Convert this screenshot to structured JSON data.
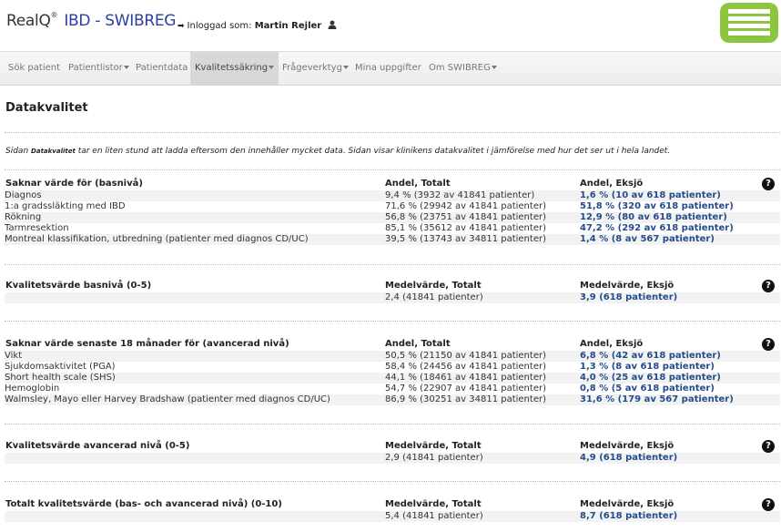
{
  "header": {
    "brand_main": "RealQ",
    "brand_reg": "®",
    "brand_sub": "IBD - SWIBREG",
    "login_prefix": "Inloggad som:",
    "user_name": "Martin Rejler",
    "colors": {
      "brand_blue": "#2a3f9e",
      "logo_green": "#8cc63f",
      "value_blue": "#244c8a"
    }
  },
  "nav": {
    "items": [
      {
        "label": "Sök patient"
      },
      {
        "label": "Patientlistor"
      },
      {
        "label": "Patientdata"
      },
      {
        "label": "Kvalitetssäkring"
      },
      {
        "label": "Frågeverktyg"
      },
      {
        "label": "Mina uppgifter"
      },
      {
        "label": "Om SWIBREG"
      }
    ]
  },
  "page": {
    "title": "Datakvalitet",
    "intro_pre": "Sidan",
    "intro_word": "Datakvalitet",
    "intro_post": "tar en liten stund att ladda eftersom den innehåller mycket data. Sidan visar klinikens datakvalitet i jämförelse med hur det ser ut i hela landet."
  },
  "sections": [
    {
      "heading": "Saknar värde för (basnivå)",
      "col2": "Andel, Totalt",
      "col3": "Andel, Eksjö",
      "rows": [
        {
          "label": "Diagnos",
          "total": "9,4 % (3932 av 41841 patienter)",
          "local": "1,6 % (10 av 618 patienter)"
        },
        {
          "label": "1:a gradssläkting med IBD",
          "total": "71,6 % (29942 av 41841 patienter)",
          "local": "51,8 % (320 av 618 patienter)"
        },
        {
          "label": "Rökning",
          "total": "56,8 % (23751 av 41841 patienter)",
          "local": "12,9 % (80 av 618 patienter)"
        },
        {
          "label": "Tarmresektion",
          "total": "85,1 % (35612 av 41841 patienter)",
          "local": "47,2 % (292 av 618 patienter)"
        },
        {
          "label": "Montreal klassifikation, utbredning (patienter med diagnos CD/UC)",
          "total": "39,5 % (13743 av 34811 patienter)",
          "local": "1,4 % (8 av 567 patienter)"
        }
      ]
    },
    {
      "heading": "Kvalitetsvärde basnivå (0-5)",
      "col2": "Medelvärde, Totalt",
      "col3": "Medelvärde, Eksjö",
      "rows": [
        {
          "label": "",
          "total": "2,4 (41841 patienter)",
          "local": "3,9 (618 patienter)"
        }
      ]
    },
    {
      "heading": "Saknar värde senaste 18 månader för (avancerad nivå)",
      "col2": "Andel, Totalt",
      "col3": "Andel, Eksjö",
      "rows": [
        {
          "label": "Vikt",
          "total": "50,5 % (21150 av 41841 patienter)",
          "local": "6,8 % (42 av 618 patienter)"
        },
        {
          "label": "Sjukdomsaktivitet (PGA)",
          "total": "58,4 % (24456 av 41841 patienter)",
          "local": "1,3 % (8 av 618 patienter)"
        },
        {
          "label": "Short health scale (SHS)",
          "total": "44,1 % (18461 av 41841 patienter)",
          "local": "4,0 % (25 av 618 patienter)"
        },
        {
          "label": "Hemoglobin",
          "total": "54,7 % (22907 av 41841 patienter)",
          "local": "0,8 % (5 av 618 patienter)"
        },
        {
          "label": "Walmsley, Mayo eller Harvey Bradshaw (patienter med diagnos CD/UC)",
          "total": "86,9 % (30251 av 34811 patienter)",
          "local": "31,6 % (179 av 567 patienter)"
        }
      ]
    },
    {
      "heading": "Kvalitetsvärde avancerad nivå (0-5)",
      "col2": "Medelvärde, Totalt",
      "col3": "Medelvärde, Eksjö",
      "rows": [
        {
          "label": "",
          "total": "2,9 (41841 patienter)",
          "local": "4,9 (618 patienter)"
        }
      ]
    },
    {
      "heading": "Totalt kvalitetsvärde (bas- och avancerad nivå) (0-10)",
      "col2": "Medelvärde, Totalt",
      "col3": "Medelvärde, Eksjö",
      "rows": [
        {
          "label": "",
          "total": "5,4 (41841 patienter)",
          "local": "8,7 (618 patienter)"
        }
      ]
    }
  ],
  "help_glyph": "?"
}
